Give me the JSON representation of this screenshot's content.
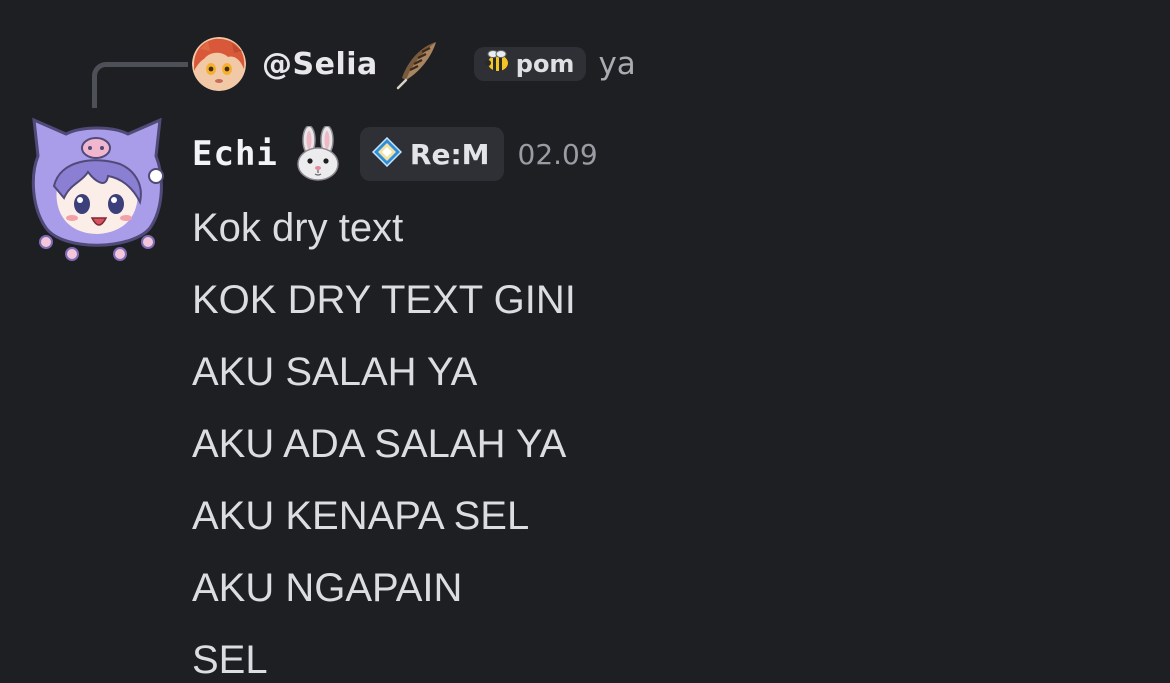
{
  "reply": {
    "avatar_icon": "orange-haired-avatar",
    "username": "@Selia",
    "username_emoji": "feather-icon",
    "role_icon": "bee-icon",
    "role_label": "pom",
    "preview_text": "ya"
  },
  "author": {
    "avatar_icon": "purple-hood-anime-avatar",
    "name": "Echi",
    "name_emoji": "rabbit-icon",
    "badge_icon": "diamond-icon",
    "badge_label": "Re:M",
    "timestamp": "02.09"
  },
  "messages": [
    "Kok dry text",
    "KOK DRY TEXT GINI",
    "AKU SALAH YA",
    "AKU ADA SALAH YA",
    "AKU KENAPA SEL",
    "AKU NGAPAIN",
    "SEL"
  ],
  "colors": {
    "background": "#1e1f23",
    "tag_background": "#2e3035",
    "text": "#dcdde1",
    "muted": "#9a9ca3"
  }
}
